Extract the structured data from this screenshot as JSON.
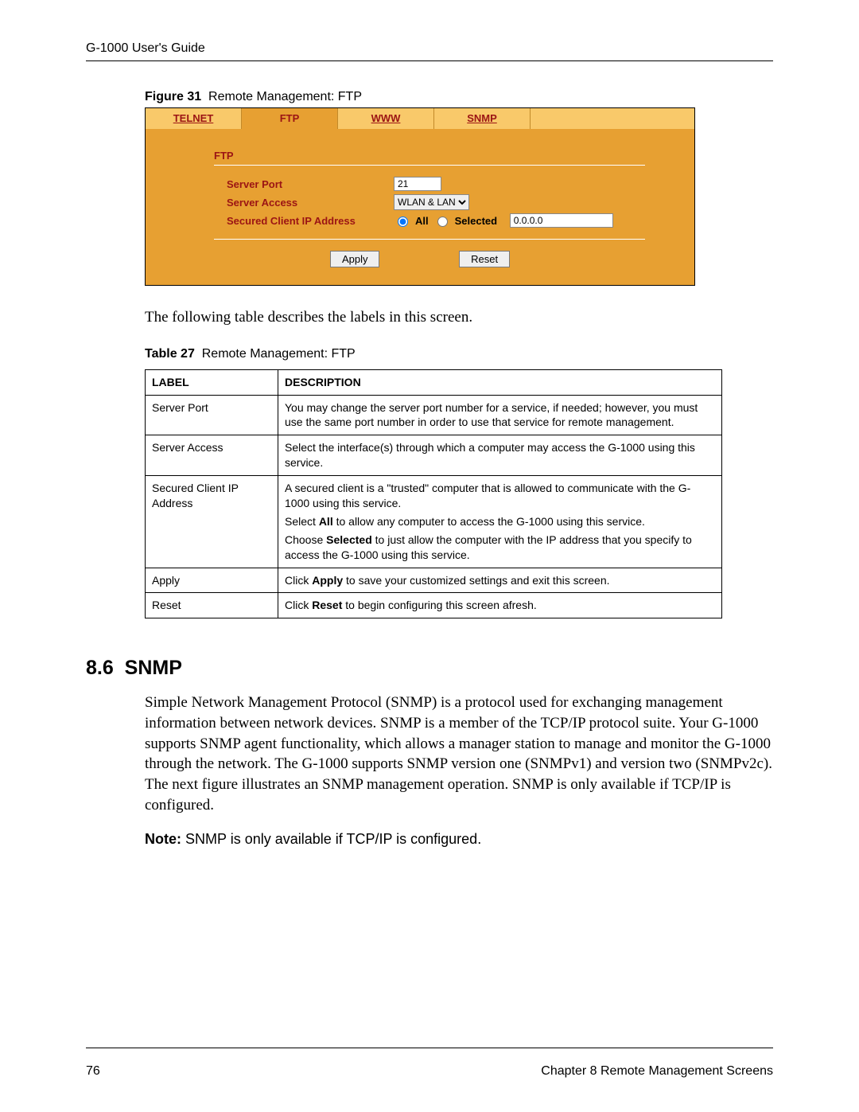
{
  "header": "G-1000 User's Guide",
  "figure": {
    "label": "Figure 31",
    "title": "Remote Management: FTP"
  },
  "tabs": {
    "items": [
      "TELNET",
      "FTP",
      "WWW",
      "SNMP"
    ],
    "active_index": 1
  },
  "panel": {
    "section_title": "FTP",
    "server_port_label": "Server Port",
    "server_port_value": "21",
    "server_access_label": "Server Access",
    "server_access_value": "WLAN & LAN",
    "secured_ip_label": "Secured Client IP Address",
    "radio_all": "All",
    "radio_selected": "Selected",
    "ip_value": "0.0.0.0",
    "apply_label": "Apply",
    "reset_label": "Reset"
  },
  "intro_text": "The following table describes the labels in this screen.",
  "table_caption": {
    "label": "Table 27",
    "title": "Remote Management: FTP"
  },
  "table": {
    "headers": [
      "LABEL",
      "DESCRIPTION"
    ],
    "rows": [
      {
        "label": "Server Port",
        "desc": [
          "You may change the server port number for a service, if needed; however, you must use the same port number in order to use that service for remote management."
        ]
      },
      {
        "label": "Server Access",
        "desc": [
          "Select the interface(s) through which a computer may access the G-1000 using this service."
        ]
      },
      {
        "label": "Secured Client IP Address",
        "desc": [
          "A secured client is a \"trusted\" computer that is allowed to communicate with the G-1000 using this service.",
          "Select <b>All</b> to allow any computer to access the G-1000 using this service.",
          "Choose <b>Selected</b> to just allow the computer with the IP address that you specify to access the G-1000 using this service."
        ]
      },
      {
        "label": "Apply",
        "desc": [
          "Click <b>Apply</b> to save your customized settings and exit this screen."
        ]
      },
      {
        "label": "Reset",
        "desc": [
          "Click <b>Reset</b> to begin configuring this screen afresh."
        ]
      }
    ]
  },
  "section": {
    "number": "8.6",
    "title": "SNMP"
  },
  "section_body": "Simple Network Management Protocol (SNMP) is a protocol used for exchanging management information between network devices. SNMP is a member of the TCP/IP protocol suite. Your G-1000 supports SNMP agent functionality, which allows a manager station to manage and monitor the G-1000 through the network. The G-1000 supports SNMP version one (SNMPv1) and version two (SNMPv2c). The next figure illustrates an SNMP management operation. SNMP is only available if TCP/IP is configured.",
  "note": {
    "label": "Note:",
    "text": "SNMP is only available if TCP/IP is configured."
  },
  "footer": {
    "page": "76",
    "chapter": "Chapter 8 Remote Management Screens"
  }
}
